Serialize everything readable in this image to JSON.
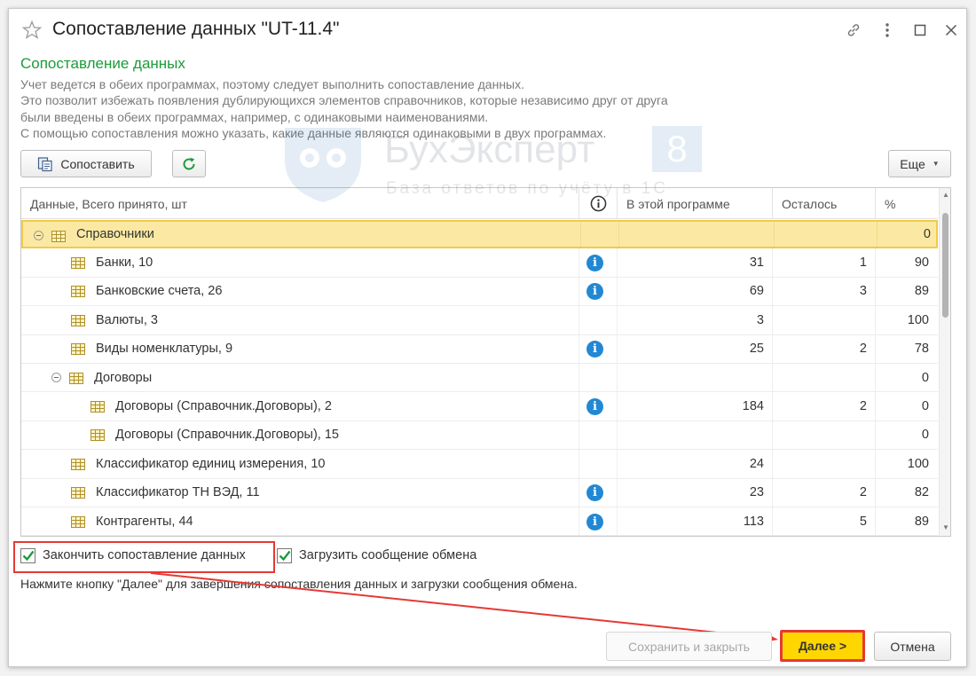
{
  "window": {
    "title": "Сопоставление данных \"UT-11.4\""
  },
  "section": {
    "title": "Сопоставление данных",
    "description_lines": [
      "Учет ведется в обеих программах, поэтому следует выполнить сопоставление данных.",
      "Это позволит избежать появления дублирующихся элементов справочников, которые независимо друг от друга",
      "были введены в обеих программах, например, с одинаковыми наименованиями.",
      "С помощью сопоставления можно указать, какие данные являются одинаковыми в двух программах."
    ]
  },
  "toolbar": {
    "match_label": "Сопоставить",
    "more_label": "Еще"
  },
  "table": {
    "headers": {
      "data": "Данные, Всего принято, шт",
      "in_program": "В этой программе",
      "remaining": "Осталось",
      "percent": "%"
    },
    "rows": [
      {
        "label": "Справочники",
        "level": 0,
        "group": true,
        "info": false,
        "in_program": "",
        "remaining": "",
        "percent": "0"
      },
      {
        "label": "Банки, 10",
        "level": 1,
        "group": false,
        "info": true,
        "in_program": "31",
        "remaining": "1",
        "percent": "90"
      },
      {
        "label": "Банковские счета, 26",
        "level": 1,
        "group": false,
        "info": true,
        "in_program": "69",
        "remaining": "3",
        "percent": "89"
      },
      {
        "label": "Валюты, 3",
        "level": 1,
        "group": false,
        "info": false,
        "in_program": "3",
        "remaining": "",
        "percent": "100"
      },
      {
        "label": "Виды номенклатуры, 9",
        "level": 1,
        "group": false,
        "info": true,
        "in_program": "25",
        "remaining": "2",
        "percent": "78"
      },
      {
        "label": "Договоры",
        "level": 1,
        "group": true,
        "info": false,
        "in_program": "",
        "remaining": "",
        "percent": "0"
      },
      {
        "label": "Договоры (Справочник.Договоры), 2",
        "level": 2,
        "group": false,
        "info": true,
        "in_program": "184",
        "remaining": "2",
        "percent": "0"
      },
      {
        "label": "Договоры (Справочник.Договоры), 15",
        "level": 2,
        "group": false,
        "info": false,
        "in_program": "",
        "remaining": "",
        "percent": "0"
      },
      {
        "label": "Классификатор единиц измерения, 10",
        "level": 1,
        "group": false,
        "info": false,
        "in_program": "24",
        "remaining": "",
        "percent": "100"
      },
      {
        "label": "Классификатор ТН ВЭД, 11",
        "level": 1,
        "group": false,
        "info": true,
        "in_program": "23",
        "remaining": "2",
        "percent": "82"
      },
      {
        "label": "Контрагенты, 44",
        "level": 1,
        "group": false,
        "info": true,
        "in_program": "113",
        "remaining": "5",
        "percent": "89"
      }
    ]
  },
  "watermark": {
    "brand": "БухЭксперт",
    "brand_number": "8",
    "tagline": "База ответов по учёту в 1С"
  },
  "options": {
    "finish_matching_label": "Закончить сопоставление данных",
    "finish_matching_checked": true,
    "load_message_label": "Загрузить сообщение обмена",
    "load_message_checked": true
  },
  "hint": "Нажмите кнопку \"Далее\" для завершения сопоставления данных и загрузки сообщения обмена.",
  "footer": {
    "save_close_label": "Сохранить и закрыть",
    "next_label": "Далее >",
    "cancel_label": "Отмена"
  },
  "colors": {
    "section_title": "#1b9c3a",
    "selected_row": "#fbe9a3",
    "highlight": "#e53935",
    "next_button": "#ffd600",
    "info_icon": "#2288d4"
  },
  "icons": {
    "favorite": "star-outline-icon",
    "link": "link-icon",
    "menu": "more-vertical-icon",
    "maximize": "maximize-icon",
    "close": "close-icon",
    "match": "match-icon",
    "refresh": "refresh-icon",
    "table": "table-icon",
    "info": "info-icon"
  }
}
